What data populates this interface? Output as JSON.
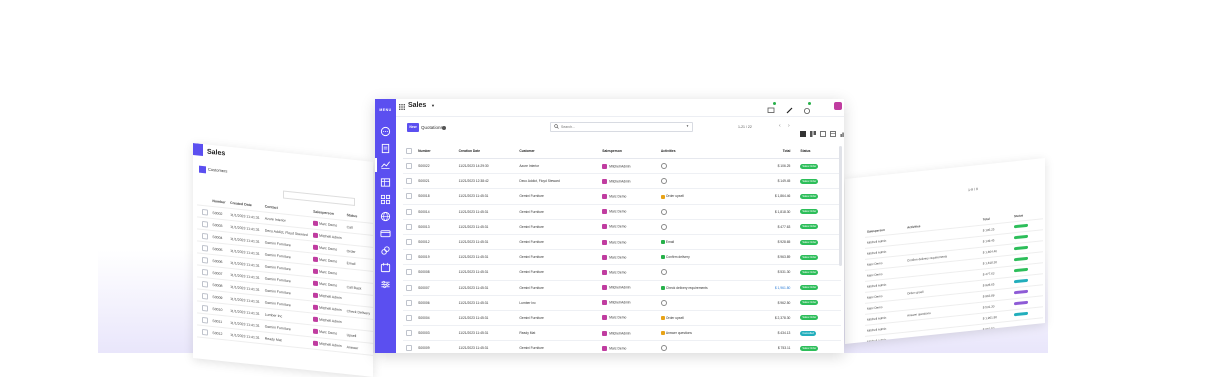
{
  "main": {
    "sidebar": {
      "menu_label": "MENU",
      "icons": [
        "chat-icon",
        "document-icon",
        "chart-icon",
        "table-icon",
        "apps-icon",
        "globe-icon",
        "card-icon",
        "link-icon",
        "calendar-icon",
        "settings-sliders-icon"
      ]
    },
    "header": {
      "title": "Sales"
    },
    "control": {
      "new_label": "New",
      "breadcrumb": "Quotations",
      "search_placeholder": "Search...",
      "pager": "1-21 / 22"
    },
    "columns": {
      "number": "Number",
      "creation_date": "Creation Date",
      "customer": "Customer",
      "salesperson": "Salesperson",
      "activities": "Activities",
      "total": "Total",
      "status": "Status"
    },
    "rows": [
      {
        "number": "S00022",
        "date": "11/21/2023 14:29:30",
        "customer": "Azure Interior",
        "salesperson": "Mitchell Admin",
        "activity": "",
        "activity_color": "",
        "total": "$ 106.25",
        "total_blue": false,
        "status": "Sales Order",
        "status_type": "sales"
      },
      {
        "number": "S00021",
        "date": "11/21/2023 12:38:42",
        "customer": "Deco Addict, Floyd Steward",
        "salesperson": "Mitchell Admin",
        "activity": "",
        "activity_color": "",
        "total": "$ 149.45",
        "total_blue": false,
        "status": "Sales Order",
        "status_type": "sales"
      },
      {
        "number": "S00018",
        "date": "11/21/2023 11:45:31",
        "customer": "Gemini Furniture",
        "salesperson": "Marc Demo",
        "activity": "Order upsell",
        "activity_color": "#e8a317",
        "total": "$ 1,864.46",
        "total_blue": false,
        "status": "Sales Order",
        "status_type": "sales"
      },
      {
        "number": "S00014",
        "date": "11/21/2023 11:45:31",
        "customer": "Gemini Furniture",
        "salesperson": "Marc Demo",
        "activity": "",
        "activity_color": "",
        "total": "$ 1,818.30",
        "total_blue": false,
        "status": "Sales Order",
        "status_type": "sales"
      },
      {
        "number": "S00013",
        "date": "11/21/2023 11:45:31",
        "customer": "Gemini Furniture",
        "salesperson": "Marc Demo",
        "activity": "",
        "activity_color": "",
        "total": "$ 477.63",
        "total_blue": false,
        "status": "Sales Order",
        "status_type": "sales"
      },
      {
        "number": "S00012",
        "date": "11/21/2023 11:45:31",
        "customer": "Gemini Furniture",
        "salesperson": "Marc Demo",
        "activity": "Email",
        "activity_color": "#27b14a",
        "total": "$ 928.65",
        "total_blue": false,
        "status": "Sales Order",
        "status_type": "sales"
      },
      {
        "number": "S00019",
        "date": "11/21/2023 11:45:31",
        "customer": "Gemini Furniture",
        "salesperson": "Marc Demo",
        "activity": "Confirm delivery",
        "activity_color": "#27b14a",
        "total": "$ 963.89",
        "total_blue": false,
        "status": "Sales Order",
        "status_type": "sales"
      },
      {
        "number": "S00008",
        "date": "11/21/2023 11:45:31",
        "customer": "Gemini Furniture",
        "salesperson": "Marc Demo",
        "activity": "",
        "activity_color": "",
        "total": "$ 531.30",
        "total_blue": false,
        "status": "Sales Order",
        "status_type": "sales"
      },
      {
        "number": "S00007",
        "date": "11/21/2023 11:45:31",
        "customer": "Gemini Furniture",
        "salesperson": "Mitchell Admin",
        "activity": "Check delivery requirements",
        "activity_color": "#27b14a",
        "total": "$ 1,961.80",
        "total_blue": true,
        "status": "Sales Order",
        "status_type": "sales"
      },
      {
        "number": "S00006",
        "date": "11/21/2023 11:45:31",
        "customer": "Lumber Inc",
        "salesperson": "Mitchell Admin",
        "activity": "",
        "activity_color": "",
        "total": "$ 962.50",
        "total_blue": false,
        "status": "Sales Order",
        "status_type": "sales"
      },
      {
        "number": "S00004",
        "date": "11/21/2023 11:45:31",
        "customer": "Gemini Furniture",
        "salesperson": "Marc Demo",
        "activity": "Order upsell",
        "activity_color": "#e8a317",
        "total": "$ 2,378.30",
        "total_blue": false,
        "status": "Sales Order",
        "status_type": "sales"
      },
      {
        "number": "S00003",
        "date": "11/21/2023 11:45:31",
        "customer": "Ready Mat",
        "salesperson": "Mitchell Admin",
        "activity": "Answer questions",
        "activity_color": "#e8a317",
        "total": "$ 434.13",
        "total_blue": false,
        "status": "Cancelled",
        "status_type": "cancel"
      },
      {
        "number": "S00009",
        "date": "11/21/2023 11:45:31",
        "customer": "Gemini Furniture",
        "salesperson": "Marc Demo",
        "activity": "",
        "activity_color": "",
        "total": "$ 753.11",
        "total_blue": false,
        "status": "Sales Order",
        "status_type": "sales"
      }
    ]
  },
  "left_window": {
    "title": "Sales",
    "breadcrumb": "Customers",
    "columns": [
      "Number",
      "Created Date",
      "Contact",
      "Salesperson",
      "Status"
    ],
    "rows": [
      [
        "S0002",
        "11/1/2023 11:41:31",
        "Azure Interior",
        "Marc Demo",
        "Call"
      ],
      [
        "S0003",
        "11/1/2023 11:41:31",
        "Deco Addict, Floyd Steward",
        "Mitchell Admin",
        ""
      ],
      [
        "S0004",
        "11/1/2023 11:41:31",
        "Gemini Furniture",
        "Marc Demo",
        "Order"
      ],
      [
        "S0005",
        "11/1/2023 11:41:31",
        "Gemini Furniture",
        "Marc Demo",
        "Email"
      ],
      [
        "S0006",
        "11/1/2023 11:41:31",
        "Gemini Furniture",
        "Marc Demo",
        ""
      ],
      [
        "S0007",
        "11/1/2023 11:41:31",
        "Gemini Furniture",
        "Marc Demo",
        "Call Back"
      ],
      [
        "S0008",
        "11/1/2023 11:41:31",
        "Gemini Furniture",
        "Mitchell Admin",
        ""
      ],
      [
        "S0009",
        "11/1/2023 11:41:31",
        "Gemini Furniture",
        "Mitchell Admin",
        "Check Delivery"
      ],
      [
        "S0010",
        "11/1/2023 11:41:31",
        "Lumber Inc",
        "Mitchell Admin",
        ""
      ],
      [
        "S0011",
        "11/1/2023 11:41:31",
        "Gemini Furniture",
        "Marc Demo",
        "Upsell"
      ],
      [
        "S0012",
        "11/1/2023 11:41:31",
        "Ready Mat",
        "Mitchell Admin",
        "Answer"
      ]
    ]
  },
  "right_window": {
    "pager": "1-8 / 8",
    "columns": [
      "Salesperson",
      "Activities",
      "Total",
      "Status"
    ],
    "rows": [
      [
        "Mitchell Admin",
        "",
        "$ 106.25",
        "sales"
      ],
      [
        "Mitchell Admin",
        "",
        "$ 149.45",
        "sales"
      ],
      [
        "Marc Demo",
        "Confirm delivery requirements",
        "$ 1,864.46",
        "sales"
      ],
      [
        "Marc Demo",
        "",
        "$ 1,818.30",
        "sales"
      ],
      [
        "Mitchell Admin",
        "",
        "$ 477.63",
        "sales"
      ],
      [
        "Marc Demo",
        "Order upsell",
        "$ 928.65",
        "blue"
      ],
      [
        "Marc Demo",
        "",
        "$ 963.89",
        "purple"
      ],
      [
        "Mitchell Admin",
        "Answer questions",
        "$ 531.30",
        "purple"
      ],
      [
        "Mitchell Admin",
        "",
        "$ 1,961.80",
        "blue"
      ],
      [
        "Mitchell Admin",
        "",
        "$ 962.50",
        ""
      ]
    ]
  },
  "colors": {
    "brand": "#5b4ff0",
    "sales_badge": "#2dbe5a",
    "cancel_badge": "#22aebc"
  }
}
